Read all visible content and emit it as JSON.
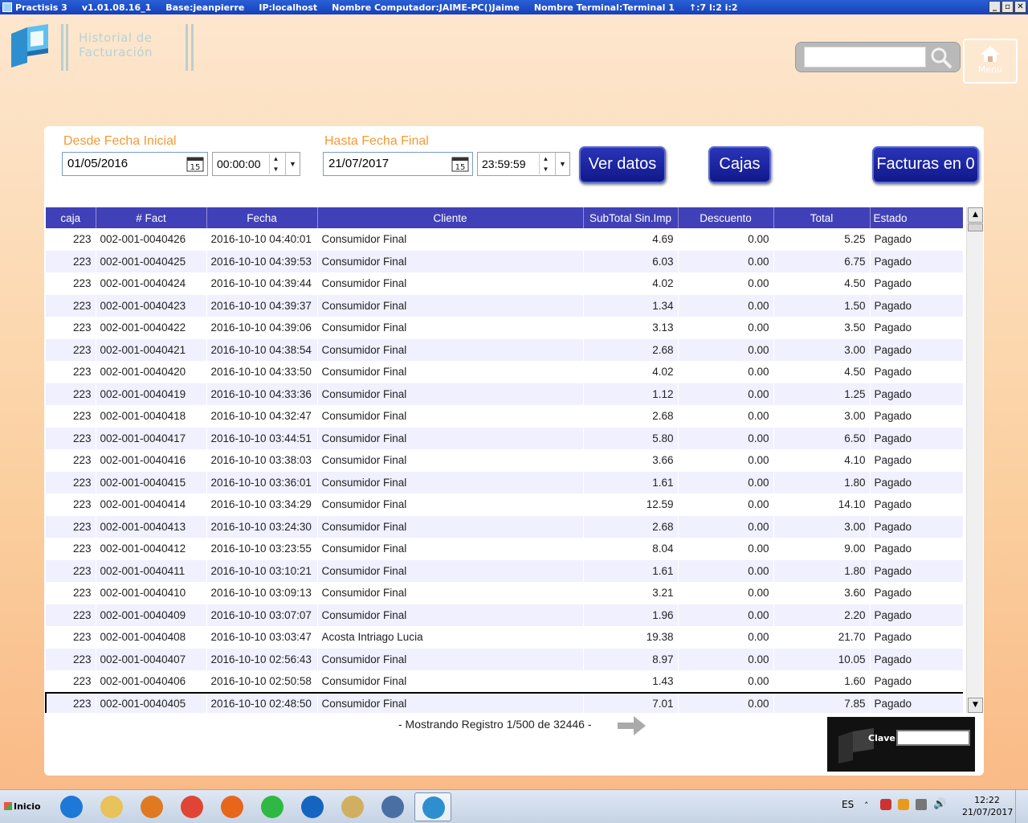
{
  "titlebar": {
    "app": "Practisis 3",
    "version": "v1.01.08.16_1",
    "base": "Base:jeanpierre",
    "ip": "IP:localhost",
    "computer": "Nombre Computador:JAIME-PC()Jaime",
    "terminal": "Nombre Terminal:Terminal 1",
    "status": "↑:7 l:2 i:2"
  },
  "header": {
    "title": "Historial de Facturación",
    "menu_label": "Menu",
    "search_placeholder": ""
  },
  "filters": {
    "from_label": "Desde Fecha Inicial",
    "from_date": "01/05/2016",
    "from_time": "00:00:00",
    "to_label": "Hasta Fecha Final",
    "to_date": "21/07/2017",
    "to_time": "23:59:59",
    "calendar_day": "15"
  },
  "buttons": {
    "ver_datos": "Ver datos",
    "cajas": "Cajas",
    "facturas": "Facturas en 0"
  },
  "table": {
    "columns": [
      "caja",
      "# Fact",
      "Fecha",
      "Cliente",
      "SubTotal Sin.Imp",
      "Descuento",
      "Total",
      "Estado"
    ],
    "rows": [
      [
        "223",
        "002-001-0040426",
        "2016-10-10 04:40:01",
        "Consumidor Final",
        "4.69",
        "0.00",
        "5.25",
        "Pagado"
      ],
      [
        "223",
        "002-001-0040425",
        "2016-10-10 04:39:53",
        "Consumidor Final",
        "6.03",
        "0.00",
        "6.75",
        "Pagado"
      ],
      [
        "223",
        "002-001-0040424",
        "2016-10-10 04:39:44",
        "Consumidor Final",
        "4.02",
        "0.00",
        "4.50",
        "Pagado"
      ],
      [
        "223",
        "002-001-0040423",
        "2016-10-10 04:39:37",
        "Consumidor Final",
        "1.34",
        "0.00",
        "1.50",
        "Pagado"
      ],
      [
        "223",
        "002-001-0040422",
        "2016-10-10 04:39:06",
        "Consumidor Final",
        "3.13",
        "0.00",
        "3.50",
        "Pagado"
      ],
      [
        "223",
        "002-001-0040421",
        "2016-10-10 04:38:54",
        "Consumidor Final",
        "2.68",
        "0.00",
        "3.00",
        "Pagado"
      ],
      [
        "223",
        "002-001-0040420",
        "2016-10-10 04:33:50",
        "Consumidor Final",
        "4.02",
        "0.00",
        "4.50",
        "Pagado"
      ],
      [
        "223",
        "002-001-0040419",
        "2016-10-10 04:33:36",
        "Consumidor Final",
        "1.12",
        "0.00",
        "1.25",
        "Pagado"
      ],
      [
        "223",
        "002-001-0040418",
        "2016-10-10 04:32:47",
        "Consumidor Final",
        "2.68",
        "0.00",
        "3.00",
        "Pagado"
      ],
      [
        "223",
        "002-001-0040417",
        "2016-10-10 03:44:51",
        "Consumidor Final",
        "5.80",
        "0.00",
        "6.50",
        "Pagado"
      ],
      [
        "223",
        "002-001-0040416",
        "2016-10-10 03:38:03",
        "Consumidor Final",
        "3.66",
        "0.00",
        "4.10",
        "Pagado"
      ],
      [
        "223",
        "002-001-0040415",
        "2016-10-10 03:36:01",
        "Consumidor Final",
        "1.61",
        "0.00",
        "1.80",
        "Pagado"
      ],
      [
        "223",
        "002-001-0040414",
        "2016-10-10 03:34:29",
        "Consumidor Final",
        "12.59",
        "0.00",
        "14.10",
        "Pagado"
      ],
      [
        "223",
        "002-001-0040413",
        "2016-10-10 03:24:30",
        "Consumidor Final",
        "2.68",
        "0.00",
        "3.00",
        "Pagado"
      ],
      [
        "223",
        "002-001-0040412",
        "2016-10-10 03:23:55",
        "Consumidor Final",
        "8.04",
        "0.00",
        "9.00",
        "Pagado"
      ],
      [
        "223",
        "002-001-0040411",
        "2016-10-10 03:10:21",
        "Consumidor Final",
        "1.61",
        "0.00",
        "1.80",
        "Pagado"
      ],
      [
        "223",
        "002-001-0040410",
        "2016-10-10 03:09:13",
        "Consumidor Final",
        "3.21",
        "0.00",
        "3.60",
        "Pagado"
      ],
      [
        "223",
        "002-001-0040409",
        "2016-10-10 03:07:07",
        "Consumidor Final",
        "1.96",
        "0.00",
        "2.20",
        "Pagado"
      ],
      [
        "223",
        "002-001-0040408",
        "2016-10-10 03:03:47",
        "Acosta Intriago Lucia",
        "19.38",
        "0.00",
        "21.70",
        "Pagado"
      ],
      [
        "223",
        "002-001-0040407",
        "2016-10-10 02:56:43",
        "Consumidor Final",
        "8.97",
        "0.00",
        "10.05",
        "Pagado"
      ],
      [
        "223",
        "002-001-0040406",
        "2016-10-10 02:50:58",
        "Consumidor Final",
        "1.43",
        "0.00",
        "1.60",
        "Pagado"
      ],
      [
        "223",
        "002-001-0040405",
        "2016-10-10 02:48:50",
        "Consumidor Final",
        "7.01",
        "0.00",
        "7.85",
        "Pagado"
      ]
    ],
    "selected_row": 21
  },
  "paging": {
    "text": "- Mostrando Registro 1/500 de 32446 -"
  },
  "clave": {
    "label": "Clave",
    "value": ""
  },
  "taskbar": {
    "start_label": "Inicio",
    "lang": "ES",
    "time": "12:22",
    "date": "21/07/2017",
    "apps": [
      "ie-icon",
      "explorer-icon",
      "media-player-icon",
      "chrome-icon",
      "firefox-icon",
      "whatsapp-icon",
      "teamviewer-icon",
      "paint-icon",
      "postgres-icon",
      "practisis-icon"
    ]
  },
  "colors": {
    "header_accent": "#4040b8",
    "label_orange": "#f39a32",
    "button_blue": "#10188a"
  }
}
